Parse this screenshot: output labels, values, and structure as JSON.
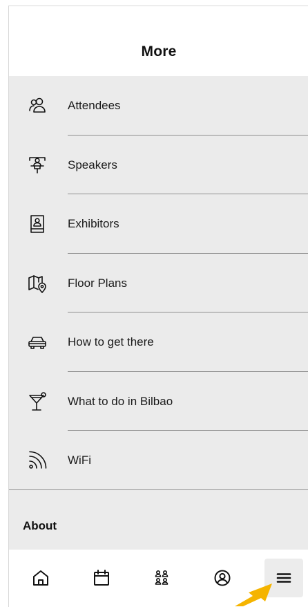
{
  "header": {
    "title": "More"
  },
  "menu": {
    "items": [
      {
        "label": "Attendees",
        "icon": "attendees-icon"
      },
      {
        "label": "Speakers",
        "icon": "speakers-icon"
      },
      {
        "label": "Exhibitors",
        "icon": "exhibitors-icon"
      },
      {
        "label": "Floor Plans",
        "icon": "floor-plans-icon"
      },
      {
        "label": "How to get there",
        "icon": "car-icon"
      },
      {
        "label": "What to do in Bilbao",
        "icon": "cocktail-icon"
      },
      {
        "label": "WiFi",
        "icon": "wifi-icon"
      }
    ]
  },
  "about": {
    "label": "About"
  },
  "tabbar": {
    "tabs": [
      {
        "icon": "home-icon"
      },
      {
        "icon": "calendar-icon"
      },
      {
        "icon": "people-icon"
      },
      {
        "icon": "profile-icon"
      },
      {
        "icon": "menu-icon",
        "active": true
      }
    ]
  },
  "colors": {
    "menu_background": "#ebebeb",
    "separator": "#8e8e8e",
    "arrow": "#f5b400",
    "active_tab": "#ececec"
  }
}
